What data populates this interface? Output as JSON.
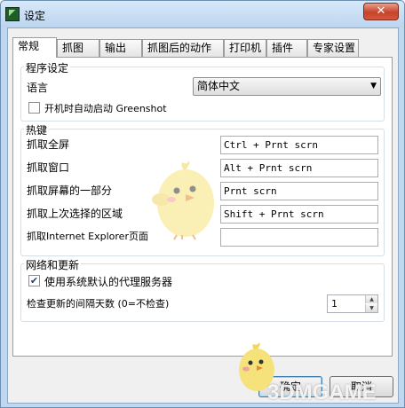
{
  "window": {
    "title": "设定",
    "close_glyph": "✕"
  },
  "tabs": [
    {
      "label": "常规",
      "active": true
    },
    {
      "label": "抓图"
    },
    {
      "label": "输出"
    },
    {
      "label": "抓图后的动作"
    },
    {
      "label": "打印机"
    },
    {
      "label": "插件"
    },
    {
      "label": "专家设置"
    }
  ],
  "program_settings": {
    "title": "程序设定",
    "language_label": "语言",
    "language_value": "简体中文",
    "dropdown_arrow": "▼",
    "autostart_label": "开机时自动启动 Greenshot",
    "autostart_checked": false
  },
  "hotkeys": {
    "title": "热键",
    "rows": [
      {
        "label": "抓取全屏",
        "value": "Ctrl + Prnt scrn"
      },
      {
        "label": "抓取窗口",
        "value": "Alt + Prnt scrn"
      },
      {
        "label": "抓取屏幕的一部分",
        "value": "Prnt scrn"
      },
      {
        "label": "抓取上次选择的区域",
        "value": "Shift + Prnt scrn"
      },
      {
        "label": "抓取Internet Explorer页面",
        "value": ""
      }
    ]
  },
  "network": {
    "title": "网络和更新",
    "proxy_label": "使用系统默认的代理服务器",
    "proxy_checked": true,
    "check_glyph": "✔",
    "update_label": "检查更新的间隔天数 (0=不检查)",
    "update_value": "1",
    "spin_up": "▲",
    "spin_down": "▼"
  },
  "buttons": {
    "ok": "确定",
    "cancel": "取消"
  },
  "watermark": "3DMGAME",
  "colors": {
    "title_bar": "#bfd7ef",
    "close_button": "#c8432b",
    "mascot": "#f6e27a"
  }
}
